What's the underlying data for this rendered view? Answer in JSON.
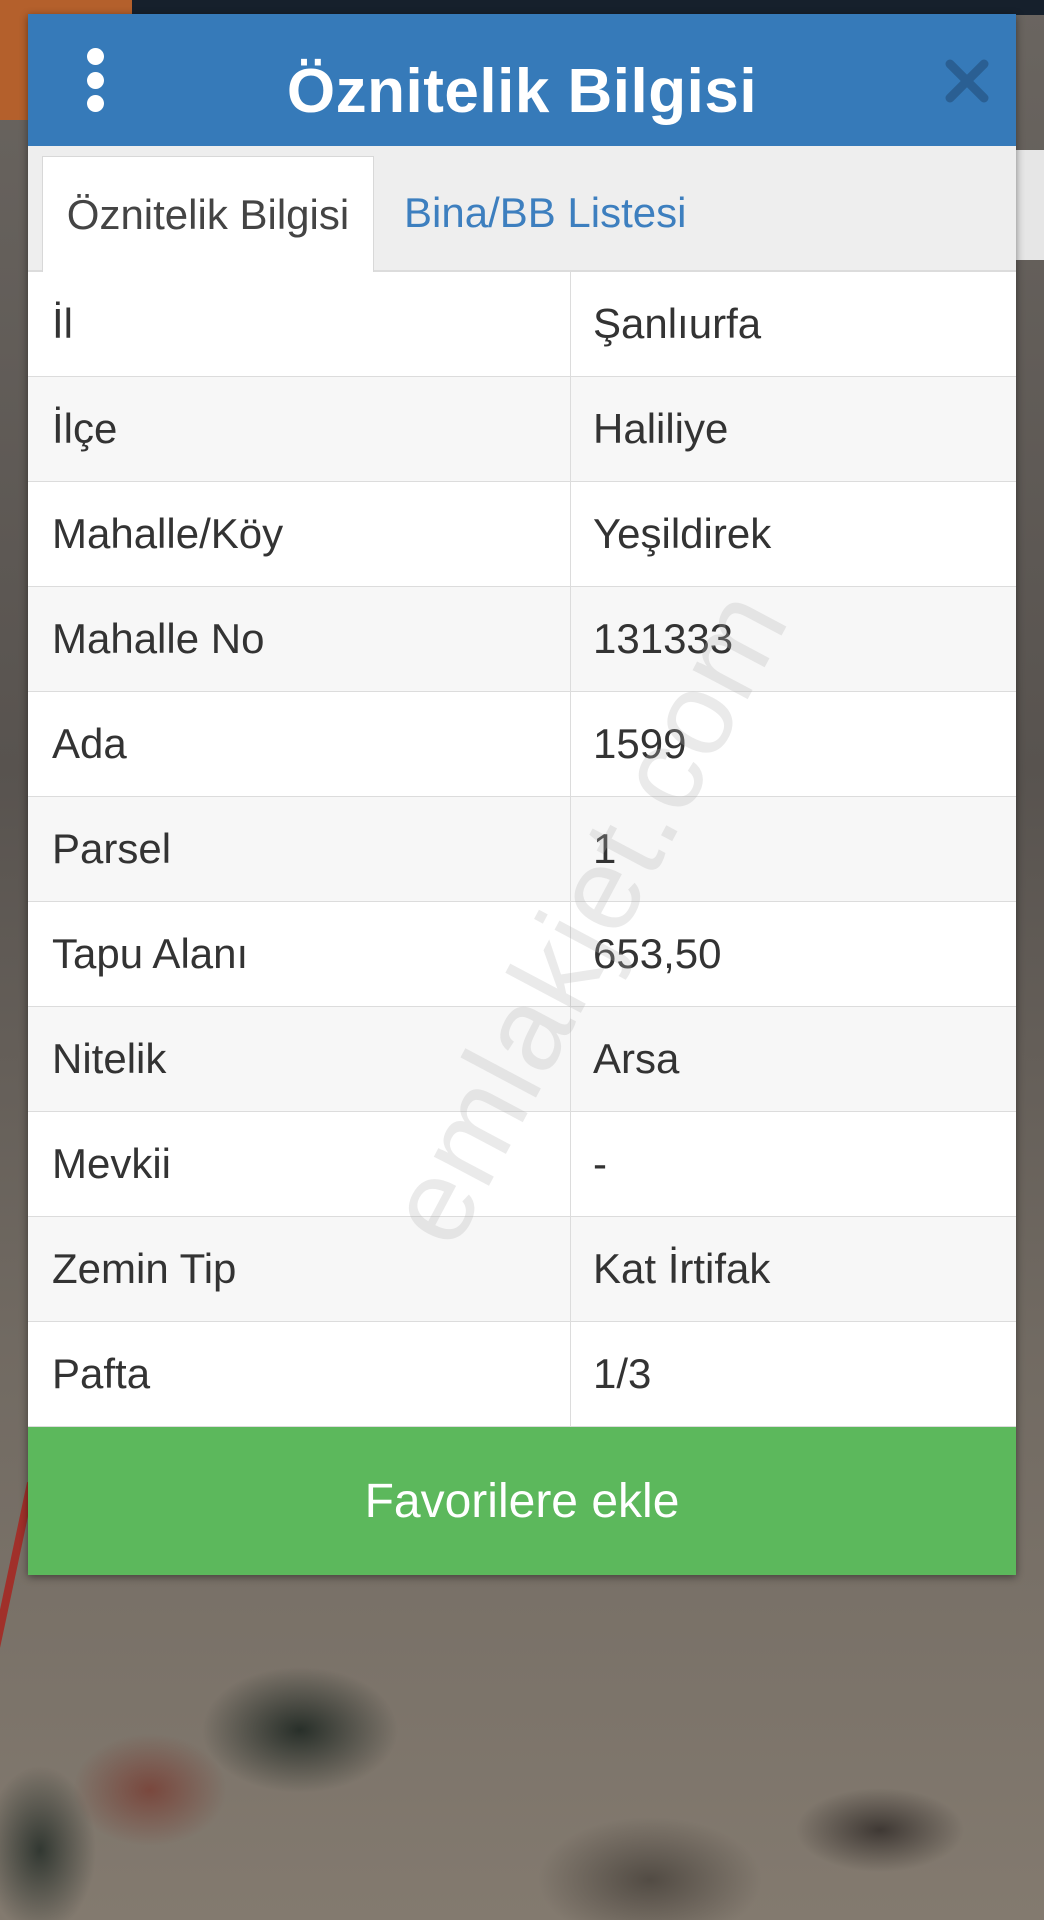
{
  "dialog": {
    "title": "Öznitelik Bilgisi",
    "menu_icon": "kebab-menu-icon",
    "close_icon": "close-icon",
    "header_color": "#367ab9"
  },
  "tabs": [
    {
      "label": "Öznitelik Bilgisi",
      "active": true
    },
    {
      "label": "Bina/BB Listesi",
      "active": false
    }
  ],
  "attributes": [
    {
      "key": "İl",
      "value": "Şanlıurfa"
    },
    {
      "key": "İlçe",
      "value": "Haliliye"
    },
    {
      "key": "Mahalle/Köy",
      "value": "Yeşildirek"
    },
    {
      "key": "Mahalle No",
      "value": "131333"
    },
    {
      "key": "Ada",
      "value": "1599"
    },
    {
      "key": "Parsel",
      "value": "1"
    },
    {
      "key": "Tapu Alanı",
      "value": "653,50"
    },
    {
      "key": "Nitelik",
      "value": "Arsa"
    },
    {
      "key": "Mevkii",
      "value": "-"
    },
    {
      "key": "Zemin Tip",
      "value": "Kat İrtifak"
    },
    {
      "key": "Pafta",
      "value": "1/3"
    }
  ],
  "favorite_button": {
    "label": "Favorilere ekle",
    "color": "#5cb85c"
  },
  "watermark": "emlakjet.com"
}
